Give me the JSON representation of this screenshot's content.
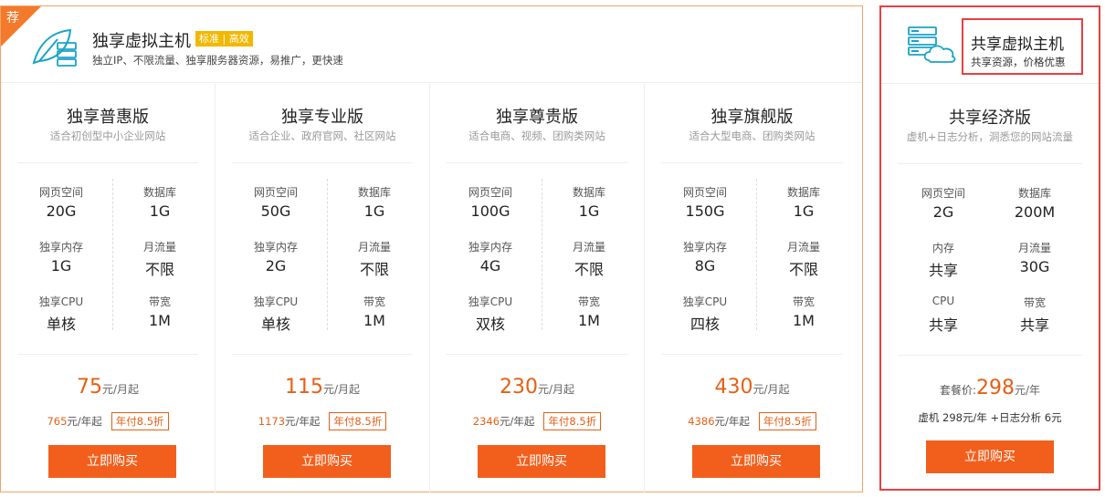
{
  "left": {
    "badge": "荐",
    "title": "独享虚拟主机",
    "tags": "标准 | 高效",
    "subtitle": "独立IP、不限流量、独享服务器资源，易推广，更快速",
    "plans": [
      {
        "name": "独享普惠版",
        "desc": "适合初创型中小企业网站",
        "specs": [
          {
            "k": "网页空间",
            "v": "20G"
          },
          {
            "k": "数据库",
            "v": "1G"
          },
          {
            "k": "独享内存",
            "v": "1G"
          },
          {
            "k": "月流量",
            "v": "不限"
          },
          {
            "k": "独享CPU",
            "v": "单核"
          },
          {
            "k": "带宽",
            "v": "1M"
          }
        ],
        "price": "75",
        "price_unit": "元/月起",
        "yearly": "765",
        "yearly_unit": "元/年起",
        "discount": "年付8.5折",
        "buy": "立即购买"
      },
      {
        "name": "独享专业版",
        "desc": "适合企业、政府官网、社区网站",
        "specs": [
          {
            "k": "网页空间",
            "v": "50G"
          },
          {
            "k": "数据库",
            "v": "1G"
          },
          {
            "k": "独享内存",
            "v": "2G"
          },
          {
            "k": "月流量",
            "v": "不限"
          },
          {
            "k": "独享CPU",
            "v": "单核"
          },
          {
            "k": "带宽",
            "v": "1M"
          }
        ],
        "price": "115",
        "price_unit": "元/月起",
        "yearly": "1173",
        "yearly_unit": "元/年起",
        "discount": "年付8.5折",
        "buy": "立即购买"
      },
      {
        "name": "独享尊贵版",
        "desc": "适合电商、视频、团购类网站",
        "specs": [
          {
            "k": "网页空间",
            "v": "100G"
          },
          {
            "k": "数据库",
            "v": "1G"
          },
          {
            "k": "独享内存",
            "v": "4G"
          },
          {
            "k": "月流量",
            "v": "不限"
          },
          {
            "k": "独享CPU",
            "v": "双核"
          },
          {
            "k": "带宽",
            "v": "1M"
          }
        ],
        "price": "230",
        "price_unit": "元/月起",
        "yearly": "2346",
        "yearly_unit": "元/年起",
        "discount": "年付8.5折",
        "buy": "立即购买"
      },
      {
        "name": "独享旗舰版",
        "desc": "适合大型电商、团购类网站",
        "specs": [
          {
            "k": "网页空间",
            "v": "150G"
          },
          {
            "k": "数据库",
            "v": "1G"
          },
          {
            "k": "独享内存",
            "v": "8G"
          },
          {
            "k": "月流量",
            "v": "不限"
          },
          {
            "k": "独享CPU",
            "v": "四核"
          },
          {
            "k": "带宽",
            "v": "1M"
          }
        ],
        "price": "430",
        "price_unit": "元/月起",
        "yearly": "4386",
        "yearly_unit": "元/年起",
        "discount": "年付8.5折",
        "buy": "立即购买"
      }
    ]
  },
  "right": {
    "title": "共享虚拟主机",
    "subtitle": "共享资源，价格优惠",
    "plan": {
      "name": "共享经济版",
      "desc": "虚机+日志分析，洞悉您的网站流量",
      "specs": [
        {
          "k": "网页空间",
          "v": "2G"
        },
        {
          "k": "数据库",
          "v": "200M"
        },
        {
          "k": "内存",
          "v": "共享"
        },
        {
          "k": "月流量",
          "v": "30G"
        },
        {
          "k": "CPU",
          "v": "共享"
        },
        {
          "k": "带宽",
          "v": "共享"
        }
      ],
      "price_prefix": "套餐价:",
      "price": "298",
      "price_unit": "元/年",
      "detail": "虚机 298元/年 +日志分析 6元",
      "buy": "立即购买"
    }
  },
  "colors": {
    "accent": "#f25f1c",
    "price": "#e65f15",
    "tag": "#f2b800",
    "highlight": "#e64040"
  }
}
